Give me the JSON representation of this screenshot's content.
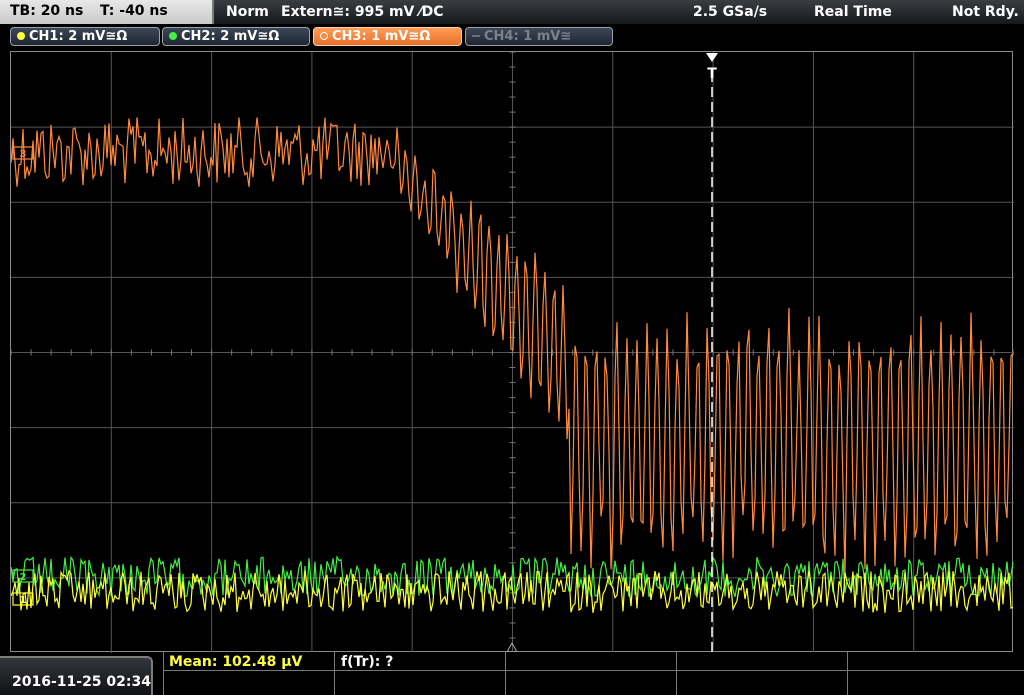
{
  "topbar": {
    "timebase": "TB: 20 ns",
    "trigger_time": "T: -40 ns",
    "mode": "Norm",
    "trigger_source": "Extern≅: 995 mV ⁄DC",
    "sample_rate": "2.5 GSa/s",
    "acq_mode": "Real Time",
    "status": "Not Rdy."
  },
  "channels": [
    {
      "label": "CH1: 2 mV≅Ω",
      "color": "#ffff3a",
      "active": true
    },
    {
      "label": "CH2: 2 mV≅Ω",
      "color": "#44ee44",
      "active": true
    },
    {
      "label": "CH3: 1 mV≅Ω",
      "color": "#ff8a3d",
      "active": true,
      "selected": true
    },
    {
      "label": "CH4: 1 mV≅",
      "color": "#6a6f76",
      "active": false
    }
  ],
  "markers": {
    "ch3": "3",
    "ch2": "2",
    "ch1": "1",
    "trigger": "T"
  },
  "measurements": {
    "mean": "Mean: 102.48 µV",
    "ftr": "f(Tr): ?"
  },
  "datetime": "2016-11-25 02:34",
  "colors": {
    "ch1": "#ffff3a",
    "ch2": "#44ee44",
    "ch3": "#ff8a3d",
    "grid": "#555555",
    "trigger_line": "#ffffff"
  }
}
